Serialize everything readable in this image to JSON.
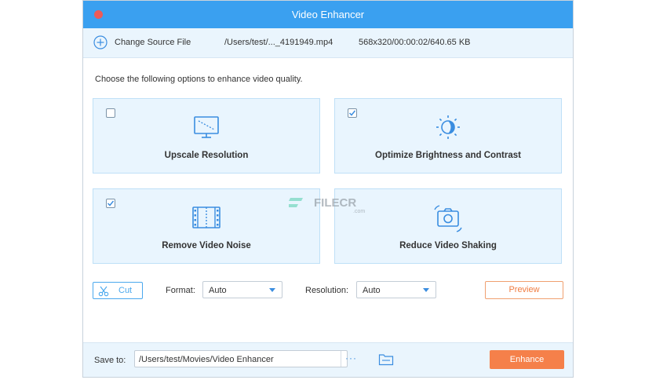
{
  "window": {
    "title": "Video Enhancer"
  },
  "source": {
    "change_label": "Change Source File",
    "file_path": "/Users/test/..._4191949.mp4",
    "file_meta": "568x320/00:00:02/640.65 KB"
  },
  "instruction": "Choose the following options to enhance video quality.",
  "options": [
    {
      "label": "Upscale Resolution",
      "checked": false,
      "icon": "monitor-icon"
    },
    {
      "label": "Optimize Brightness and Contrast",
      "checked": true,
      "icon": "brightness-icon"
    },
    {
      "label": "Remove Video Noise",
      "checked": true,
      "icon": "film-icon"
    },
    {
      "label": "Reduce Video Shaking",
      "checked": false,
      "icon": "camera-shake-icon"
    }
  ],
  "toolbar": {
    "cut_label": "Cut",
    "format_label": "Format:",
    "format_value": "Auto",
    "resolution_label": "Resolution:",
    "resolution_value": "Auto",
    "preview_label": "Preview"
  },
  "save": {
    "label": "Save to:",
    "path": "/Users/test/Movies/Video Enhancer",
    "browse_label": "···",
    "enhance_label": "Enhance"
  },
  "watermark": {
    "text": "FILECR",
    "sub": ".com"
  },
  "colors": {
    "accent": "#3aa0f0",
    "card_bg": "#e9f5fe",
    "enhance": "#f5804a",
    "close": "#ee5a58"
  }
}
